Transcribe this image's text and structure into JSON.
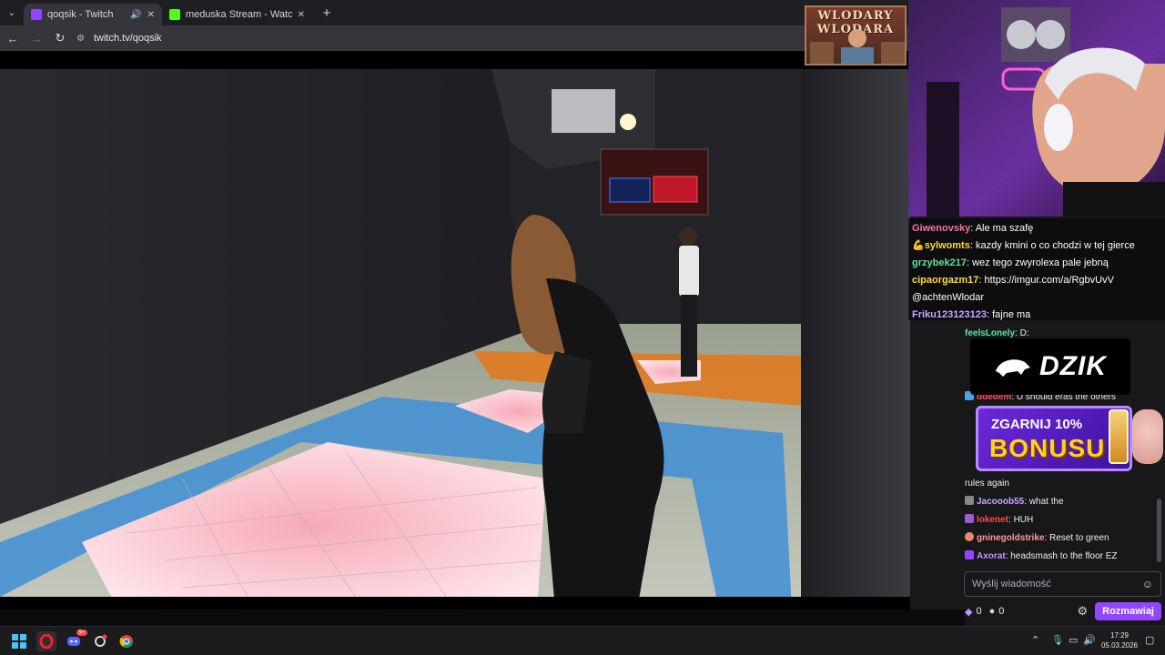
{
  "browser": {
    "tabs": [
      {
        "title": "qoqsik - Twitch",
        "favicon_color": "#9147ff"
      },
      {
        "title": "meduska Stream - Watch Live o",
        "favicon_color": "#53fc18"
      }
    ],
    "new_tab_label": "+",
    "url": "twitch.tv/qoqsik"
  },
  "stream": {
    "badge_text": "WLODARY WLODARA"
  },
  "overlay_chat": [
    {
      "user": "Giwenovsky",
      "color": "#ff6fb0",
      "text": "Ale ma szafę"
    },
    {
      "user": "sylwomts",
      "color": "#ffd93b",
      "text": "kazdy kmini o co chodzi w tej gierce"
    },
    {
      "user": "grzybek217",
      "color": "#5ee3a0",
      "text": "wez tego zwyrolexa pale jebną"
    },
    {
      "user": "cipaorgazm17",
      "color": "#ffd93b",
      "text": "https://imgur.com/a/RgbvUvV"
    },
    {
      "user": "",
      "color": "#ffffff",
      "text": "@achtenWlodar"
    },
    {
      "user": "Friku123123123",
      "color": "#c9a6ff",
      "text": "fajne ma"
    }
  ],
  "chat": {
    "messages": [
      {
        "user": "feelsLonely",
        "color": "#5ee3a0",
        "text": "D:"
      },
      {
        "user": "ddedem",
        "color": "#ff4b4b",
        "text": "U should eras the others"
      },
      {
        "user": "",
        "color": "#efeff1",
        "text": "rules again"
      },
      {
        "user": "Jacooob55",
        "color": "#c9a6ff",
        "text": "what the"
      },
      {
        "user": "lokenet",
        "color": "#ff4b4b",
        "text": "HUH"
      },
      {
        "user": "gninegoldstrike",
        "color": "#ff9a9a",
        "text": "Reset to green"
      },
      {
        "user": "Axorat",
        "color": "#bf94ff",
        "text": "headsmash to the floor EZ"
      }
    ],
    "dzik_banner": "DZIK",
    "bonus_line1": "ZGARNIJ 10%",
    "bonus_line2": "BONUSU",
    "input_placeholder": "Wyślij wiadomość",
    "points_a": "0",
    "points_b": "0",
    "send_label": "Rozmawiaj"
  },
  "taskbar": {
    "time": "17:29",
    "date": "05.03.2026",
    "discord_badge": "9+"
  }
}
